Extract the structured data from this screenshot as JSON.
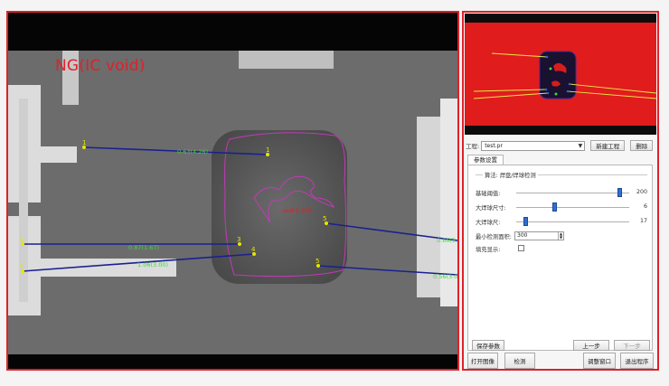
{
  "main_view": {
    "verdict": "NG(IC void)",
    "measurements": [
      {
        "label": "0.63(4.26)"
      },
      {
        "label": "0.87(1.67)"
      },
      {
        "label": "1.06(3.00)"
      },
      {
        "label": "0.66(3.0)"
      },
      {
        "label": "0.56(3.0)"
      }
    ],
    "void_label": "void:5.36%",
    "point_ids": [
      "1",
      "1",
      "3",
      "3",
      "4",
      "4",
      "5",
      "5"
    ]
  },
  "panel": {
    "project_label": "工程:",
    "project_value": "test.pr",
    "new_project_button": "新建工程",
    "delete_button": "删除",
    "tab_label": "参数设置",
    "group_title": "算法: 焊盘/焊球检测",
    "params": [
      {
        "label": "基础阈值:",
        "value": "200",
        "fraction": 0.93
      },
      {
        "label": "大焊球尺寸:",
        "value": "6",
        "fraction": 0.33
      },
      {
        "label": "大焊球尺:",
        "value": "17",
        "fraction": 0.07
      }
    ],
    "min_area_label": "最小检测面积:",
    "min_area_value": "300",
    "fill_display_label": "填充显示:",
    "save_params_button": "保存参数",
    "prev_button": "上一步",
    "next_button": "下一步",
    "open_image_button": "打开图像",
    "detect_button": "检测",
    "draw_window_button": "调整窗口",
    "exit_button": "退出程序"
  }
}
